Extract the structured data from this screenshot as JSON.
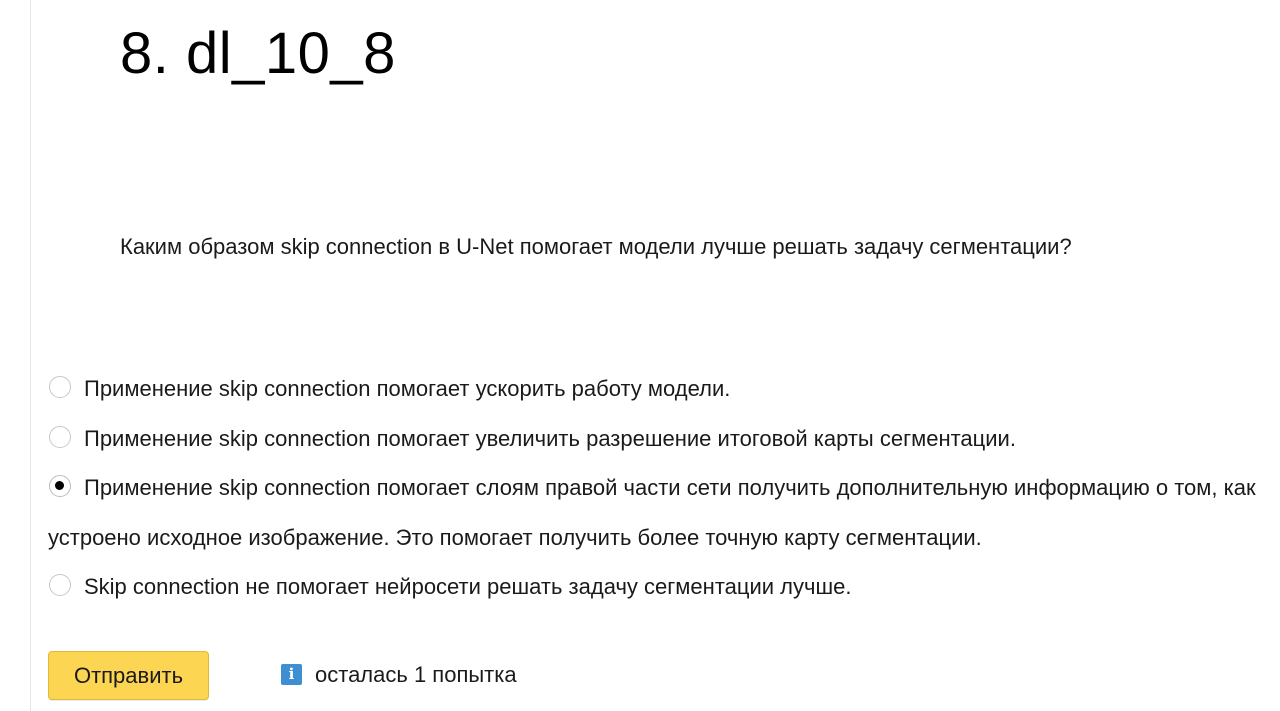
{
  "task": {
    "title": "8. dl_10_8"
  },
  "question": {
    "text": "Каким образом skip connection в U-Net помогает модели лучше решать задачу сегментации?"
  },
  "options": [
    {
      "label": "Применение skip connection помогает ускорить работу модели.",
      "selected": false
    },
    {
      "label": "Применение skip connection помогает увеличить разрешение итоговой карты сегментации.",
      "selected": false
    },
    {
      "label": "Применение skip connection помогает слоям правой части сети получить дополнительную информацию о том, как устроено исходное изображение. Это помогает получить более точную карту сегментации.",
      "selected": true
    },
    {
      "label": "Skip connection не помогает нейросети решать задачу сегментации лучше.",
      "selected": false
    }
  ],
  "actions": {
    "submit_label": "Отправить"
  },
  "attempts": {
    "icon": "info-icon",
    "text": "осталась 1 попытка"
  },
  "colors": {
    "submit_button": "#fcd552",
    "info_icon": "#3d8fd1"
  }
}
